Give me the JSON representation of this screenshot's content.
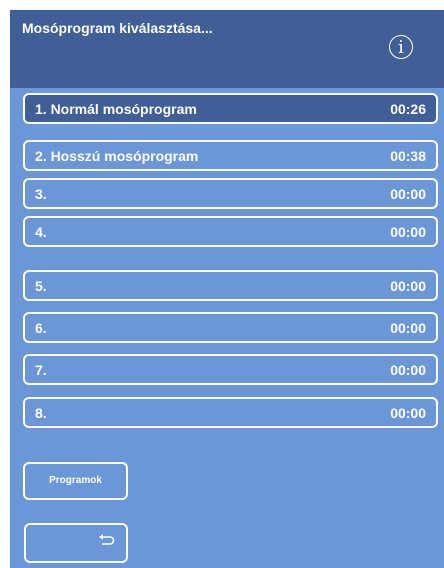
{
  "header": {
    "title": "Mosóprogram kiválasztása...",
    "info_glyph": "i"
  },
  "programs": [
    {
      "name": "1. Normál mosóprogram",
      "time": "00:26"
    },
    {
      "name": "2. Hosszú mosóprogram",
      "time": "00:38"
    },
    {
      "name": "3.",
      "time": "00:00"
    },
    {
      "name": "4.",
      "time": "00:00"
    },
    {
      "name": "5.",
      "time": "00:00"
    },
    {
      "name": "6.",
      "time": "00:00"
    },
    {
      "name": "7.",
      "time": "00:00"
    },
    {
      "name": "8.",
      "time": "00:00"
    }
  ],
  "buttons": {
    "programs_label": "Programok",
    "back_icon": "return-arrow-icon"
  },
  "colors": {
    "panel": "#6b97d8",
    "header": "#3f5f96",
    "text": "#ffffff",
    "border": "#ffffff"
  }
}
